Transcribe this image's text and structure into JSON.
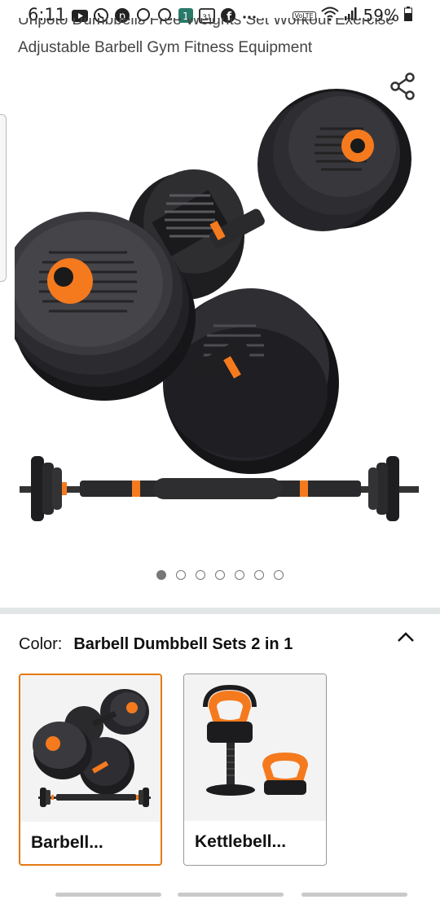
{
  "status_bar": {
    "time": "6:11",
    "battery": "59%",
    "icons": [
      "youtube-icon",
      "whatsapp-icon",
      "pinterest-icon",
      "chat-bubble-icon",
      "chat-bubble-icon",
      "notification-icon",
      "calendar-icon",
      "facebook-icon",
      "more-icon",
      "volte-icon",
      "wifi-icon",
      "signal-icon",
      "battery-icon"
    ],
    "calendar_day": "31",
    "volte": "VoLTE"
  },
  "product": {
    "title_line1": "Unpoto Dumbbells Free Weights Set Workout Exercise",
    "title_line2": "Adjustable Barbell Gym Fitness Equipment"
  },
  "carousel": {
    "count": 7,
    "active_index": 0
  },
  "variation": {
    "label": "Color:",
    "selected_value": "Barbell Dumbbell Sets 2 in 1",
    "options": [
      {
        "label": "Barbell...",
        "selected": true
      },
      {
        "label": "Kettlebell...",
        "selected": false
      }
    ]
  },
  "colors": {
    "accent": "#e47911",
    "plate": "#2b2b2e",
    "orange": "#f57a1e",
    "divider": "#e3e6e6"
  }
}
